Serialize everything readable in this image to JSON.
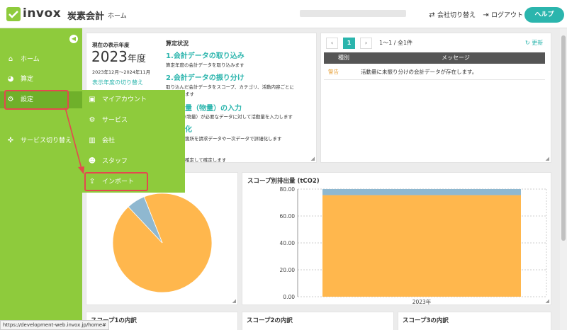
{
  "header": {
    "logo_text": "invox",
    "logo_sub": "炭素会計",
    "home": "ホーム",
    "switch_company": "会社切り替え",
    "logout": "ログアウト",
    "help": "ヘルプ"
  },
  "sidebar": {
    "items": [
      {
        "label": "ホーム"
      },
      {
        "label": "算定"
      },
      {
        "label": "設定"
      },
      {
        "label": "サービス切り替え"
      }
    ]
  },
  "submenu": {
    "items": [
      {
        "label": "マイアカウント"
      },
      {
        "label": "サービス"
      },
      {
        "label": "会社"
      },
      {
        "label": "スタッフ"
      },
      {
        "label": "インポート"
      }
    ]
  },
  "display_year": {
    "label": "現在の表示年度",
    "year": "2023",
    "year_unit": "年度",
    "range": "2023年12月〜2024年11月",
    "switch_link": "表示年度の切り替え"
  },
  "calc_status": {
    "title": "算定状況",
    "steps": [
      {
        "heading": "1.会計データの取り込み",
        "desc": "算定年度の会計データを取り込みます"
      },
      {
        "heading": "2.会計データの振り分け",
        "desc": "取り込んだ会計データをスコープ、カテゴリ、活動内容ごとに",
        "desc2": "ます"
      },
      {
        "heading": "量（物量）の入力",
        "desc": "(物量）が必要なデータに対して活動量を入力します"
      },
      {
        "heading": "化",
        "desc": "箇所を請求データや一次データで詳細化します"
      },
      {
        "heading": "",
        "desc": "確定して確定します"
      }
    ]
  },
  "messages": {
    "page": "1",
    "page_info": "1〜1 / 全1件",
    "refresh": "更新",
    "col_type": "種別",
    "col_message": "メッセージ",
    "rows": [
      {
        "type": "警告",
        "message": "活動量に未振り分けの会計データが存在します。"
      }
    ]
  },
  "scope_chart": {
    "title": "スコープ別排出量 (tCO2)"
  },
  "chart_data": [
    {
      "type": "pie",
      "values": [
        94,
        6
      ],
      "colors": [
        "#ffb74d",
        "#8fb8d0"
      ]
    },
    {
      "type": "bar",
      "title": "スコープ別排出量 (tCO2)",
      "categories": [
        "2023年"
      ],
      "series": [
        {
          "values": [
            75.5
          ],
          "color": "#ffb74d"
        },
        {
          "values": [
            4.5
          ],
          "color": "#8fb8d0"
        }
      ],
      "ylim": [
        0,
        80
      ],
      "yticks": [
        "0.00",
        "20.00",
        "40.00",
        "60.00",
        "80.00"
      ],
      "grid": true
    }
  ],
  "bottom": {
    "scope1": "スコープ1の内訳",
    "scope2": "スコープ2の内訳",
    "scope3": "スコープ3の内訳"
  },
  "status_url": "https://development-web.invox.jp/home#",
  "colors": {
    "brand_green": "#8ecb3c",
    "teal": "#2bb5ad",
    "highlight_red": "#e4484f"
  }
}
